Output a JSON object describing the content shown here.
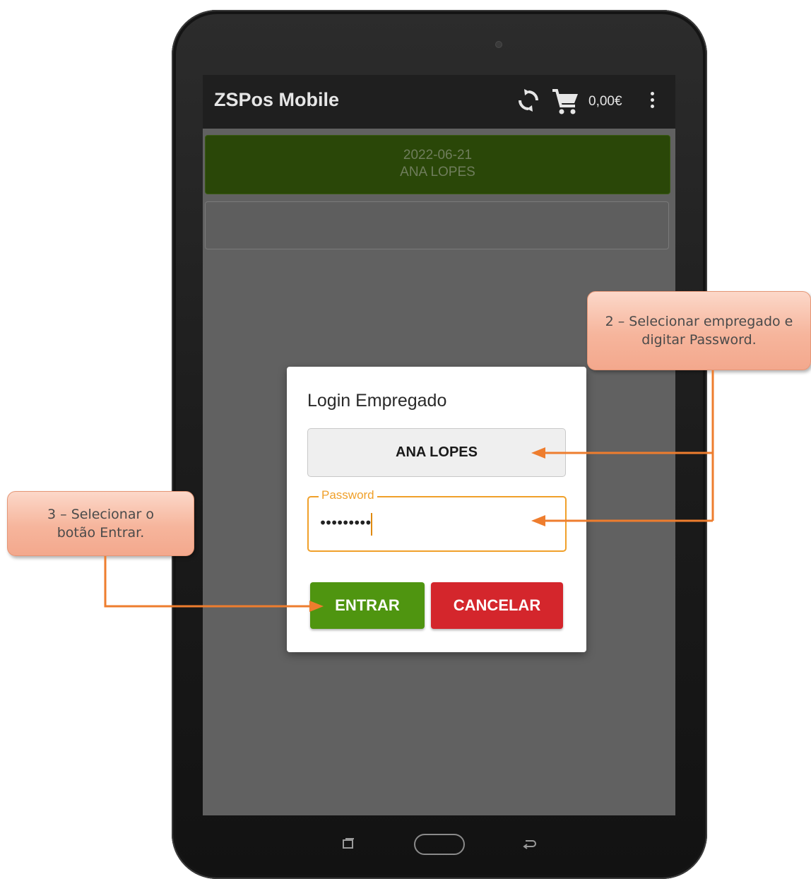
{
  "app": {
    "title": "ZSPos Mobile",
    "total": "0,00€",
    "icons": [
      "sync-icon",
      "cart-icon",
      "overflow-menu-icon"
    ]
  },
  "session": {
    "date": "2022-06-21",
    "employee": "ANA LOPES"
  },
  "dialog": {
    "title": "Login Empregado",
    "employee_selected": "ANA LOPES",
    "password_label": "Password",
    "password_value": "•••••••••",
    "enter_label": "ENTRAR",
    "cancel_label": "CANCELAR"
  },
  "callouts": {
    "step2": "2 – Selecionar empregado e digitar Password.",
    "step3": "3 – Selecionar o botão Entrar."
  },
  "colors": {
    "appbar": "#1f1f1f",
    "session_card": "#2a4708",
    "enter_button": "#4f9510",
    "cancel_button": "#d4262c",
    "focus_orange": "#f0a02a",
    "callout": "#f6b59c",
    "arrow": "#ee7d2e"
  }
}
